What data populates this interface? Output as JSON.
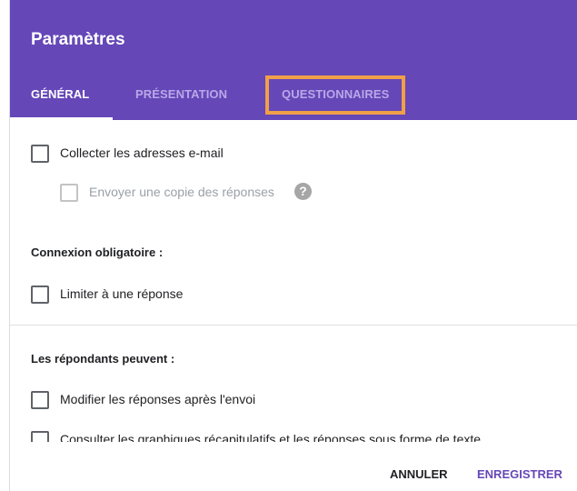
{
  "dialog": {
    "title": "Paramètres",
    "tabs": [
      {
        "label": "GÉNÉRAL"
      },
      {
        "label": "PRÉSENTATION"
      },
      {
        "label": "QUESTIONNAIRES"
      }
    ]
  },
  "general": {
    "collect_email": "Collecter les adresses e-mail",
    "send_copy": "Envoyer une copie des réponses",
    "help_glyph": "?",
    "login_required_title": "Connexion obligatoire :",
    "limit_one": "Limiter à une réponse",
    "respondents_title": "Les répondants peuvent :",
    "edit_after": "Modifier les réponses après l'envoi",
    "see_summary": "Consulter les graphiques récapitulatifs et les réponses sous forme de texte"
  },
  "footer": {
    "cancel": "ANNULER",
    "save": "ENREGISTRER"
  },
  "colors": {
    "header": "#6547b7",
    "highlight": "#f0a048"
  }
}
